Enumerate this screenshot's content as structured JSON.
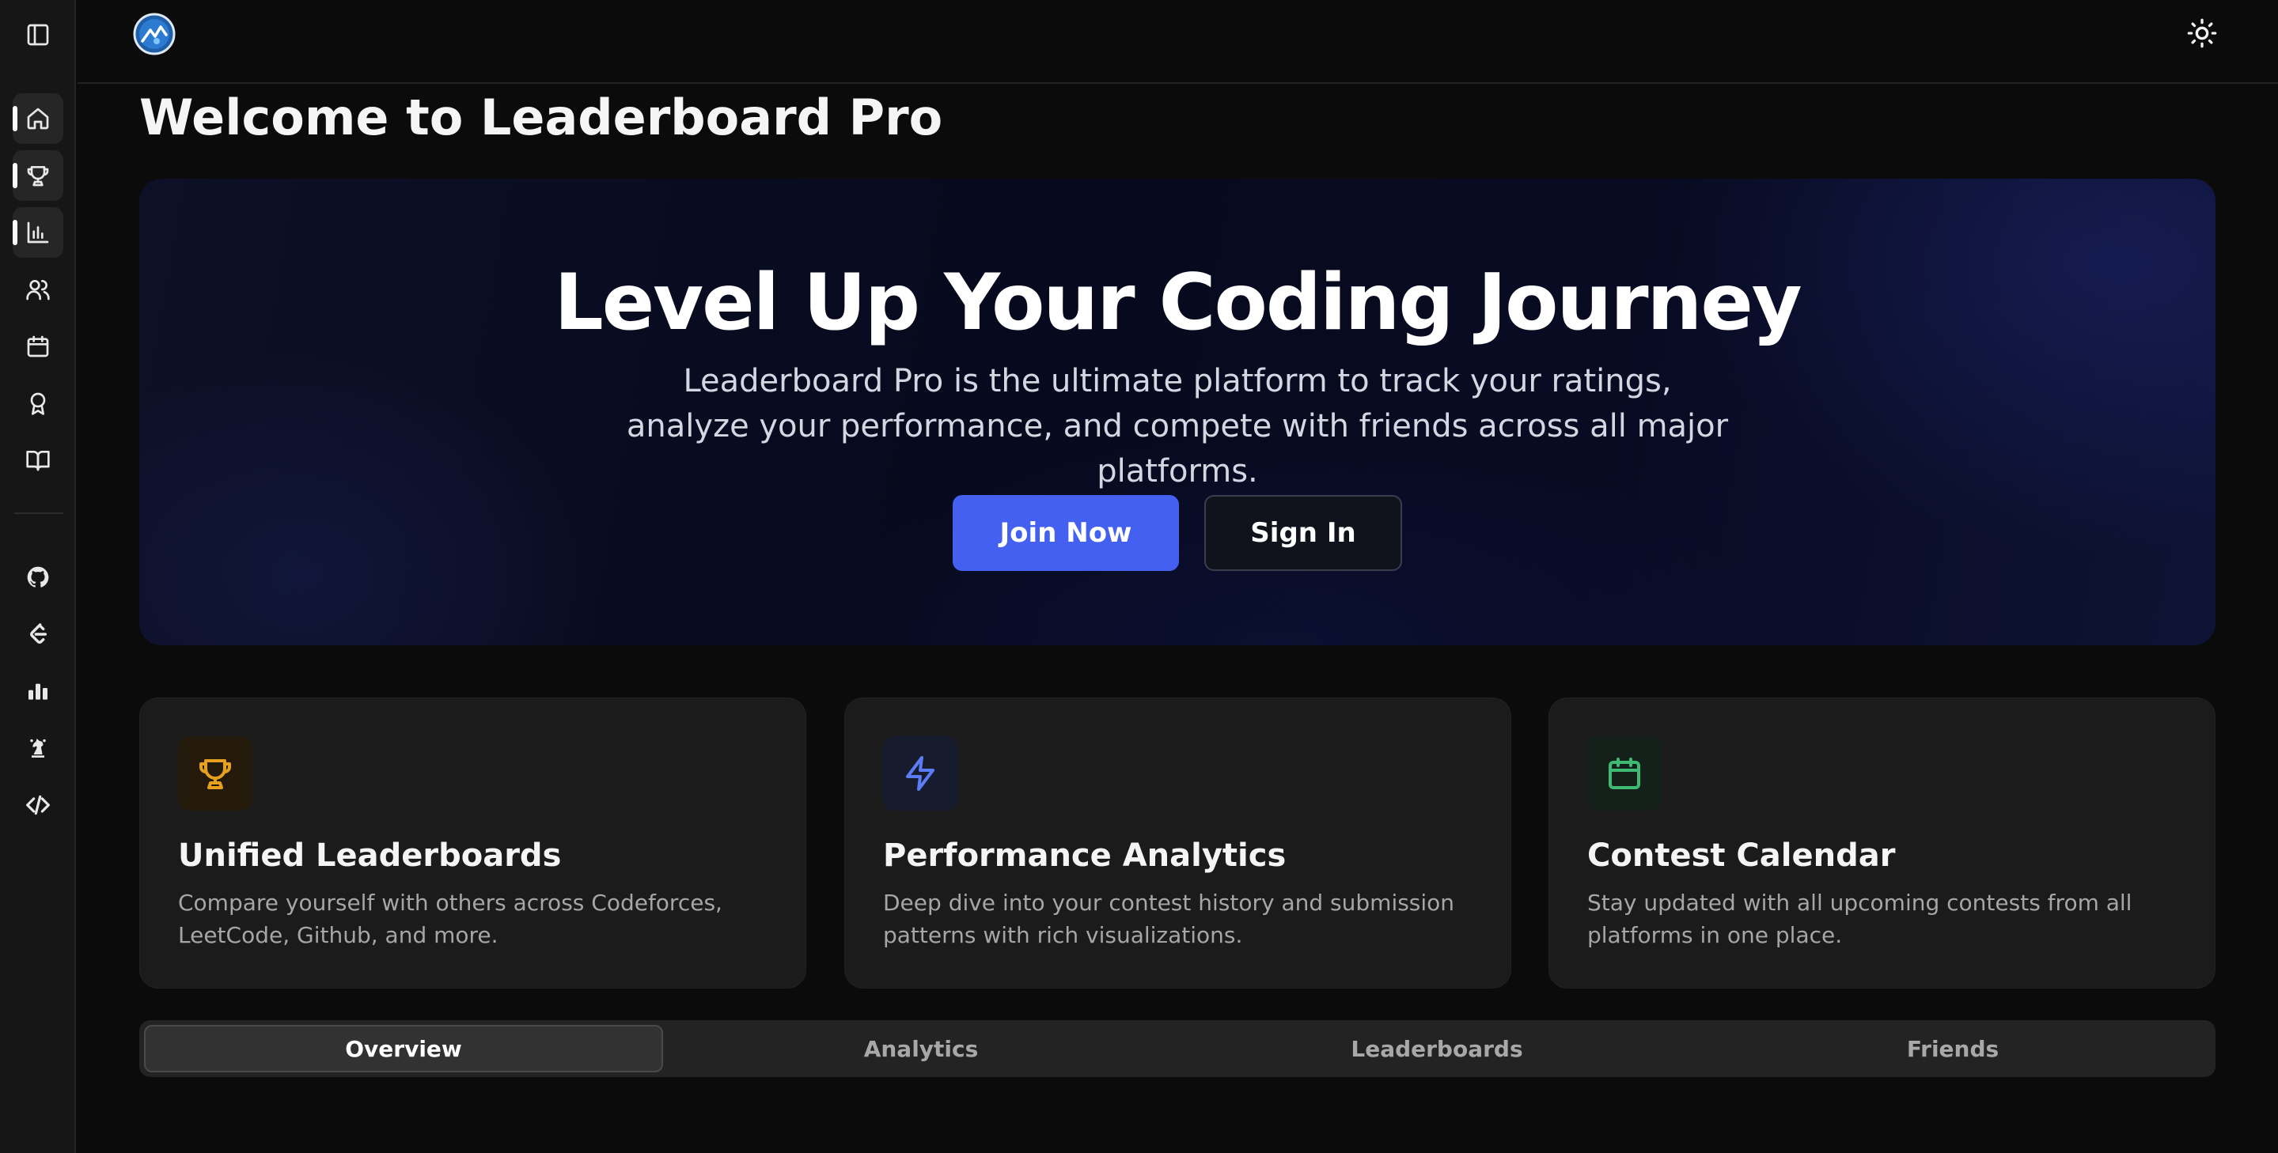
{
  "app": {
    "title": "Leaderboard Pro"
  },
  "sidebar": {
    "toggle_icon": "sidebar-toggle-icon",
    "nav_items": [
      {
        "icon": "home-icon",
        "active": true
      },
      {
        "icon": "trophy-icon",
        "active": true
      },
      {
        "icon": "bar-chart-icon",
        "active": true
      },
      {
        "icon": "users-icon",
        "active": false
      },
      {
        "icon": "calendar-icon",
        "active": false
      },
      {
        "icon": "award-icon",
        "active": false
      },
      {
        "icon": "book-icon",
        "active": false
      }
    ],
    "platform_items": [
      {
        "icon": "github-icon"
      },
      {
        "icon": "leetcode-icon"
      },
      {
        "icon": "codechef-icon"
      },
      {
        "icon": "chess-knight-icon"
      },
      {
        "icon": "code-icon"
      }
    ]
  },
  "topbar": {
    "logo_icon": "app-logo",
    "theme_icon": "sun-icon"
  },
  "main": {
    "page_title": "Welcome to Leaderboard Pro",
    "hero": {
      "title": "Level Up Your Coding Journey",
      "subtitle": "Leaderboard Pro is the ultimate platform to track your ratings, analyze your performance, and compete with friends across all major platforms.",
      "primary_button": "Join Now",
      "secondary_button": "Sign In",
      "colors": {
        "primary": "#4460f0"
      }
    },
    "features": [
      {
        "icon": "trophy-icon",
        "title": "Unified Leaderboards",
        "description": "Compare yourself with others across Codeforces, LeetCode, Github, and more.",
        "color": "#e6a020"
      },
      {
        "icon": "zap-icon",
        "title": "Performance Analytics",
        "description": "Deep dive into your contest history and submission patterns with rich visualizations.",
        "color": "#5b7cf5"
      },
      {
        "icon": "calendar-icon",
        "title": "Contest Calendar",
        "description": "Stay updated with all upcoming contests from all platforms in one place.",
        "color": "#3fba72"
      }
    ],
    "tabs": [
      {
        "label": "Overview",
        "active": true
      },
      {
        "label": "Analytics",
        "active": false
      },
      {
        "label": "Leaderboards",
        "active": false
      },
      {
        "label": "Friends",
        "active": false
      }
    ]
  }
}
